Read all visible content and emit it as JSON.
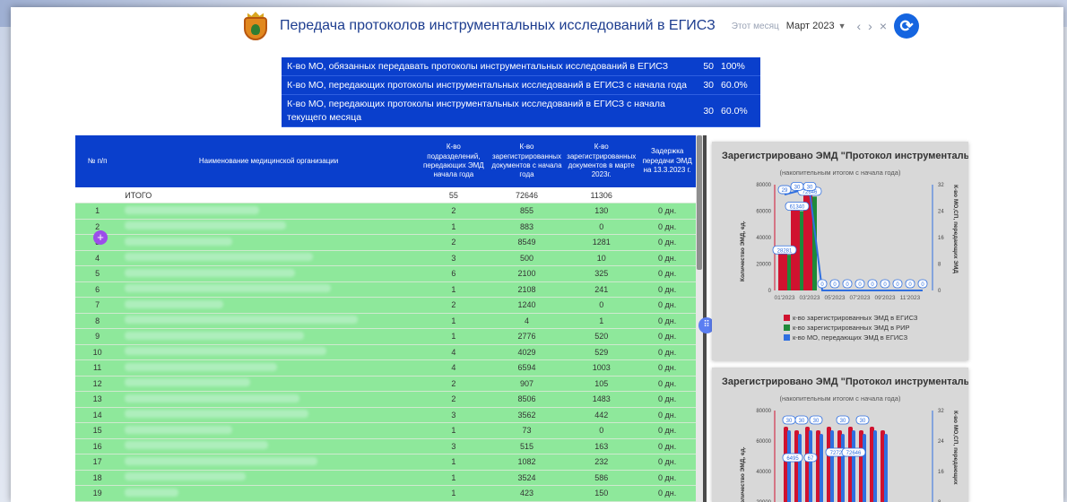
{
  "header": {
    "title": "Передача протоколов инструментальных исследований в ЕГИСЗ",
    "month_label": "Этот месяц",
    "month_value": "Март 2023",
    "prev": "‹",
    "next": "›",
    "clear": "×"
  },
  "summary": [
    {
      "text": "К-во МО, обязанных передавать протоколы инструментальных исследований в ЕГИСЗ",
      "num": "50",
      "pct": "100%"
    },
    {
      "text": "К-во МО, передающих протоколы инструментальных исследований в ЕГИСЗ с начала года",
      "num": "30",
      "pct": "60.0%"
    },
    {
      "text": "К-во МО, передающих протоколы инструментальных исследований в ЕГИСЗ с начала текущего месяца",
      "num": "30",
      "pct": "60.0%"
    }
  ],
  "table": {
    "headers": [
      "№ п/п",
      "Наименование медицинской организации",
      "К-во подразделений, передающих ЭМД начала года",
      "К-во зарегистрированных документов с начала года",
      "К-во зарегистрированных документов в марте 2023г.",
      "Задержка передачи ЭМД на 13.3.2023 г."
    ],
    "total": {
      "label": "ИТОГО",
      "a": "55",
      "b": "72646",
      "c": "11306"
    },
    "rows": [
      {
        "n": "1",
        "a": "2",
        "b": "855",
        "c": "130",
        "d": "0 дн."
      },
      {
        "n": "2",
        "a": "1",
        "b": "883",
        "c": "0",
        "d": "0 дн."
      },
      {
        "n": "3",
        "a": "2",
        "b": "8549",
        "c": "1281",
        "d": "0 дн."
      },
      {
        "n": "4",
        "a": "3",
        "b": "500",
        "c": "10",
        "d": "0 дн."
      },
      {
        "n": "5",
        "a": "6",
        "b": "2100",
        "c": "325",
        "d": "0 дн."
      },
      {
        "n": "6",
        "a": "1",
        "b": "2108",
        "c": "241",
        "d": "0 дн."
      },
      {
        "n": "7",
        "a": "2",
        "b": "1240",
        "c": "0",
        "d": "0 дн."
      },
      {
        "n": "8",
        "a": "1",
        "b": "4",
        "c": "1",
        "d": "0 дн."
      },
      {
        "n": "9",
        "a": "1",
        "b": "2776",
        "c": "520",
        "d": "0 дн."
      },
      {
        "n": "10",
        "a": "4",
        "b": "4029",
        "c": "529",
        "d": "0 дн."
      },
      {
        "n": "11",
        "a": "4",
        "b": "6594",
        "c": "1003",
        "d": "0 дн."
      },
      {
        "n": "12",
        "a": "2",
        "b": "907",
        "c": "105",
        "d": "0 дн."
      },
      {
        "n": "13",
        "a": "2",
        "b": "8506",
        "c": "1483",
        "d": "0 дн."
      },
      {
        "n": "14",
        "a": "3",
        "b": "3562",
        "c": "442",
        "d": "0 дн."
      },
      {
        "n": "15",
        "a": "1",
        "b": "73",
        "c": "0",
        "d": "0 дн."
      },
      {
        "n": "16",
        "a": "3",
        "b": "515",
        "c": "163",
        "d": "0 дн."
      },
      {
        "n": "17",
        "a": "1",
        "b": "1082",
        "c": "232",
        "d": "0 дн."
      },
      {
        "n": "18",
        "a": "1",
        "b": "3524",
        "c": "586",
        "d": "0 дн."
      },
      {
        "n": "19",
        "a": "1",
        "b": "423",
        "c": "150",
        "d": "0 дн."
      }
    ]
  },
  "colors": {
    "accent": "#0a3fcc",
    "row_green": "#8ee89b",
    "bar_red": "#d0122f",
    "bar_green": "#1f8a3a",
    "bar_blue": "#2f6fe0"
  },
  "chart_data": [
    {
      "type": "bar",
      "title": "Зарегистрировано ЭМД \"Протокол инструментальных",
      "subtitle": "(накопительным итогом с начала года)",
      "ylabel": "Количество ЭМД, ед.",
      "y2label": "К-во МО,СП, передающих ЭМД",
      "ylim": [
        0,
        80000
      ],
      "y2lim": [
        0,
        32
      ],
      "yticks": [
        "80000",
        "60000",
        "40000",
        "20000",
        "0"
      ],
      "y2ticks": [
        "32",
        "24",
        "16",
        "8",
        "0"
      ],
      "xticks": [
        "01'2023",
        "03'2023",
        "05'2023",
        "07'2023",
        "09'2023",
        "11'2023"
      ],
      "categories": [
        "01'2023",
        "02'2023",
        "03'2023",
        "04'2023",
        "05'2023",
        "06'2023",
        "07'2023",
        "08'2023",
        "09'2023",
        "10'2023",
        "11'2023",
        "12'2023"
      ],
      "series": [
        {
          "name": "к-во зарегистрированных ЭМД в ЕГИСЗ",
          "values": [
            28281,
            61340,
            72646,
            0,
            0,
            0,
            0,
            0,
            0,
            0,
            0,
            0
          ]
        },
        {
          "name": "к-во зарегистрированных ЭМД в РИР",
          "values": [
            27000,
            60000,
            71000,
            0,
            0,
            0,
            0,
            0,
            0,
            0,
            0,
            0
          ]
        },
        {
          "name": "к-во МО, передающих ЭМД в ЕГИСЗ",
          "values": [
            29,
            30,
            30,
            0,
            0,
            0,
            0,
            0,
            0,
            0,
            0,
            0
          ]
        }
      ],
      "point_labels": [
        "28281",
        "61340",
        "72646",
        "29",
        "30",
        "30",
        "0",
        "0",
        "0",
        "0",
        "0",
        "0",
        "0",
        "0",
        "0"
      ]
    },
    {
      "type": "bar",
      "title": "Зарегистрировано ЭМД \"Протокол инструментальных",
      "subtitle": "(накопительным итогом с начала года)",
      "ylabel": "Количество ЭМД, ед.",
      "y2label": "К-во МО,СП, передающих",
      "yticks": [
        "80000",
        "60000",
        "40000",
        "20000"
      ],
      "y2ticks": [
        "32",
        "24",
        "16",
        "8"
      ],
      "point_labels": [
        "30",
        "30",
        "30",
        "30",
        "30",
        "6495",
        "67",
        "72723",
        "72646"
      ]
    }
  ]
}
